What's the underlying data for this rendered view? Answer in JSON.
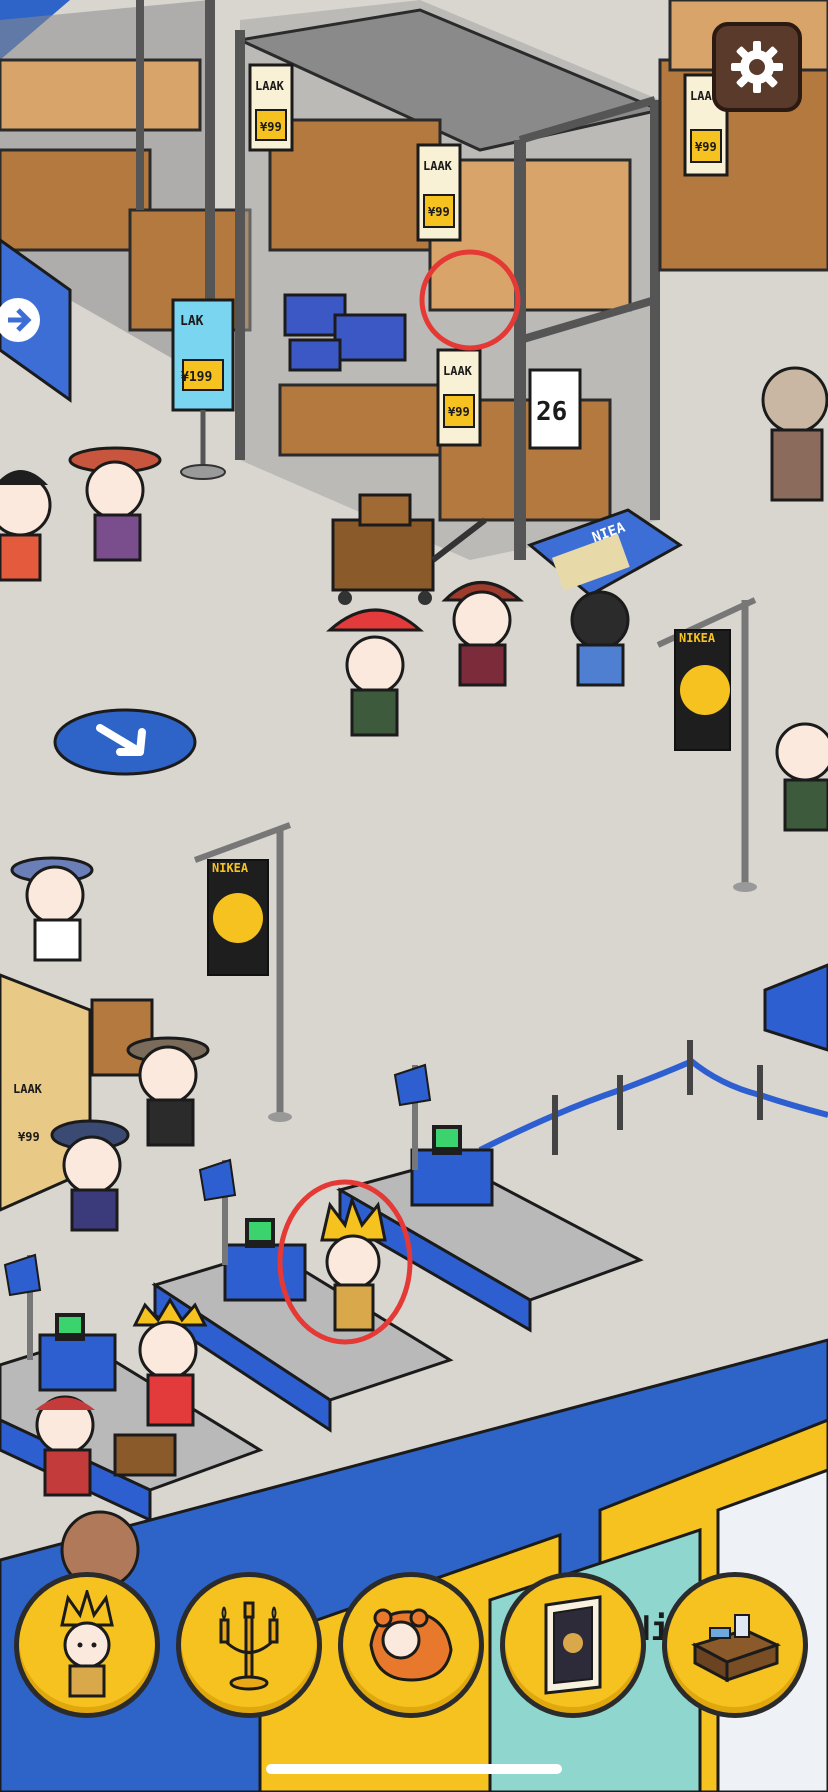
{
  "game": {
    "settings_icon": "gear-icon",
    "price_tag": {
      "brand": "LAAK",
      "price": "¥99"
    },
    "price_tag_large": {
      "brand": "LAK",
      "price": "¥199"
    },
    "shelf_number": "26",
    "banner_brand": "NIKEA",
    "kiosk_brand": "NIEA",
    "store_sign_fragment": "Ni",
    "highlight_color": "#e53935",
    "accent_blue": "#2e63c7",
    "accent_yellow": "#f6c21f"
  },
  "hotbar": {
    "items": [
      {
        "name": "crowned-kid-item",
        "icon": "crowned-character-icon"
      },
      {
        "name": "candelabra-item",
        "icon": "candelabra-icon"
      },
      {
        "name": "sleeping-bag-item",
        "icon": "sleeping-bag-icon"
      },
      {
        "name": "picture-frame-item",
        "icon": "picture-frame-icon"
      },
      {
        "name": "desk-item",
        "icon": "desk-icon"
      }
    ]
  }
}
